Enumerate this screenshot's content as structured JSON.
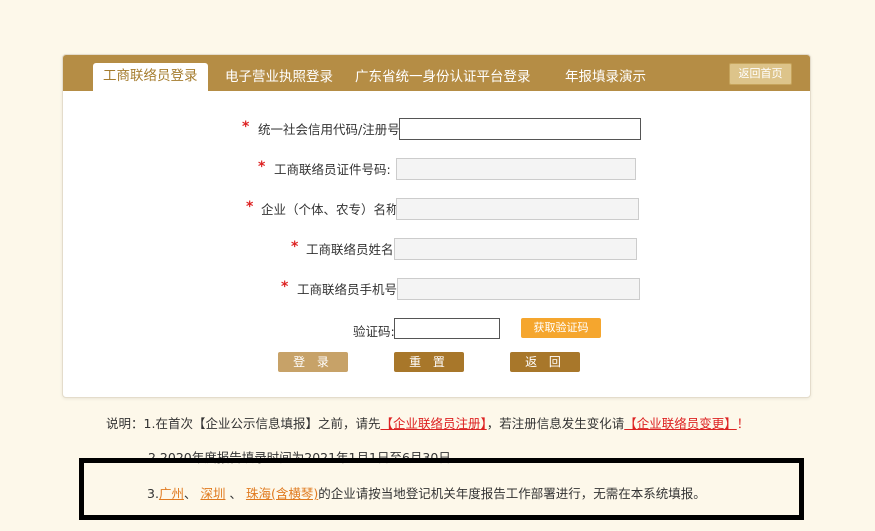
{
  "tabs": [
    {
      "label": "工商联络员登录"
    },
    {
      "label": "电子营业执照登录"
    },
    {
      "label": "广东省统一身份认证平台登录"
    },
    {
      "label": "年报填录演示"
    }
  ],
  "home_button": "返回首页",
  "form": {
    "credit_code_label": "统一社会信用代码/注册号:",
    "id_no_label": "工商联络员证件号码:",
    "company_name_label": "企业（个体、农专）名称:",
    "contact_name_label": "工商联络员姓名:",
    "phone_label": "工商联络员手机号:",
    "captcha_label": "验证码:",
    "get_code_button": "获取验证码",
    "required_mark": "*"
  },
  "buttons": {
    "login": "登 录",
    "reset": "重 置",
    "back": "返 回"
  },
  "notes": {
    "prefix": "说明：",
    "line1_a": "1.在首次【企业公示信息填报】之前，请先",
    "line1_link1": "【企业联络员注册】",
    "line1_b": "，若注册信息发生变化请",
    "line1_link2": "【企业联络员变更】",
    "line1_c": "！",
    "line2": "2.2020年度报告填录时间为2021年1月1日至6月30日",
    "line3_a": "3.",
    "line3_city1": "广州",
    "line3_sep1": "、",
    "line3_city2": "深圳",
    "line3_sep2": "、",
    "line3_city3": "珠海(含横琴)",
    "line3_b": "的企业请按当地登记机关年度报告工作部署进行，无需在本系统填报。"
  },
  "colors": {
    "tabbar": "#b58d45",
    "get_code": "#f5a62e",
    "login_btn": "#c7a268",
    "reset_btn": "#a8772a",
    "back_btn": "#a8772a"
  }
}
